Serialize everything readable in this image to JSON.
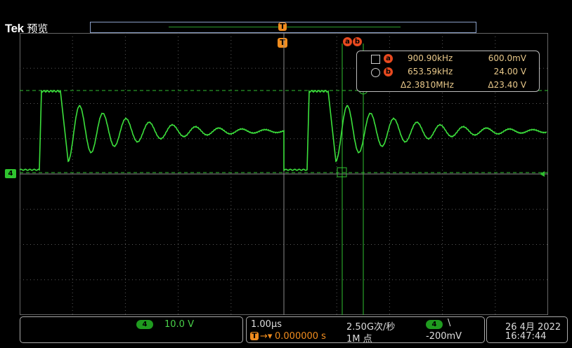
{
  "brand": {
    "name": "Tek",
    "mode": "预览"
  },
  "trigger_marker": "T",
  "cursor_labels": {
    "a": "a",
    "b": "b"
  },
  "channel": {
    "number": "4"
  },
  "cursor_readout": {
    "a": {
      "freq": "900.90kHz",
      "volt": "600.0mV"
    },
    "b": {
      "freq": "653.59kHz",
      "volt": "24.00 V"
    },
    "delta": {
      "freq": "Δ2.3810MHz",
      "volt": "Δ23.40 V"
    }
  },
  "vertical": {
    "channel": "4",
    "scale": "10.0 V"
  },
  "horizontal": {
    "time_per_div": "1.00µs",
    "sample_rate": "2.50G次/秒",
    "record_length": "1M 点",
    "trigger_position": "0.000000 s",
    "trigger_channel": "4",
    "trigger_slope": "\\",
    "trigger_level": "-200mV"
  },
  "datetime": {
    "date": "26 4月 2022",
    "time": "16:47:44"
  },
  "colors": {
    "trace": "#3ce03c",
    "cursor": "#2fbf2f",
    "marker": "#f08c1e",
    "cursor_badge": "#e8491f"
  }
}
